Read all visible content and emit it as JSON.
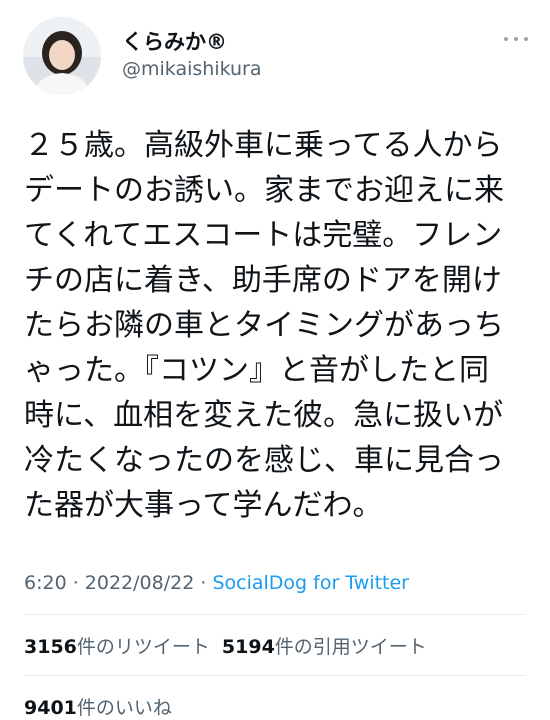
{
  "user": {
    "display_name": "くらみか®",
    "handle": "@mikaishikura"
  },
  "tweet": {
    "lines": [
      "２５歳。高級外車に乗ってる人から",
      "デートのお誘い。家までお迎えに来",
      "てくれてエスコートは完璧。フレン",
      "チの店に着き、助手席のドアを開け",
      "たらお隣の車とタイミングがあっち",
      "ゃった。『コツン』と音がしたと同",
      "時に、血相を変えた彼。急に扱いが",
      "冷たくなったのを感じ、車に見合っ",
      "た器が大事って学んだわ。"
    ],
    "time": "6:20",
    "separator": " · ",
    "date": "2022/08/22",
    "source": "SocialDog for Twitter"
  },
  "stats": {
    "retweets_count": "3156",
    "retweets_label": "件のリツイート",
    "quotes_count": "5194",
    "quotes_label": "件の引用ツイート",
    "likes_count": "9401",
    "likes_label": "件のいいね"
  },
  "colors": {
    "text": "#0f1419",
    "muted": "#536471",
    "link": "#1d9bf0",
    "divider": "#e6ecf0"
  }
}
